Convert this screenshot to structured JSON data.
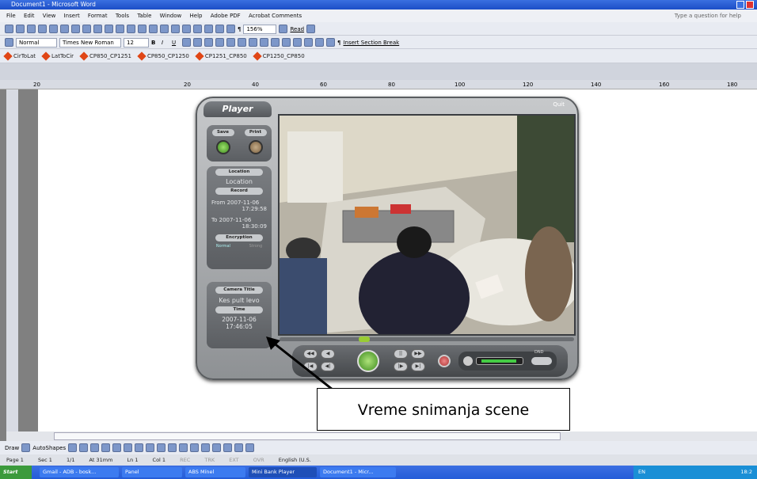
{
  "window": {
    "title": "Document1 - Microsoft Word",
    "help_placeholder": "Type a question for help"
  },
  "menu": [
    "File",
    "Edit",
    "View",
    "Insert",
    "Format",
    "Tools",
    "Table",
    "Window",
    "Help",
    "Adobe PDF",
    "Acrobat Comments"
  ],
  "toolbar": {
    "zoom": "156%",
    "read_label": "Read",
    "style": "Normal",
    "font": "Times New Roman",
    "size": "12",
    "insert_section_break": "Insert Section Break"
  },
  "macros": [
    "CirToLat",
    "LatToCir",
    "CP850_CP1251",
    "CP850_CP1250",
    "CP1251_CP850",
    "CP1250_CP850"
  ],
  "ruler_marks": [
    "20",
    "20",
    "40",
    "60",
    "80",
    "100",
    "120",
    "140",
    "160",
    "180"
  ],
  "player": {
    "title": "Player",
    "quit": "Quit",
    "save_label": "Save",
    "print_label": "Print",
    "location_header": "Location",
    "location_value": "Location",
    "record_header": "Record",
    "from_label": "From",
    "from_date": "2007-11-06",
    "from_time": "17:29:58",
    "to_label": "To",
    "to_date": "2007-11-06",
    "to_time": "18:30:09",
    "encryption_header": "Encryption",
    "encryption_normal": "Normal",
    "encryption_strong": "Strong",
    "camera_title_header": "Camera Title",
    "camera_title_value": "Kes pult levo",
    "time_header": "Time",
    "time_date": "2007-11-06",
    "time_clock": "17:46:05",
    "dnd_label": "DND"
  },
  "annotation": "Vreme snimanja scene",
  "draw_toolbar": {
    "draw": "Draw",
    "autoshapes": "AutoShapes"
  },
  "status": {
    "page": "Page 1",
    "sec": "Sec 1",
    "pages": "1/1",
    "at": "At 31mm",
    "ln": "Ln 1",
    "col": "Col 1",
    "rec": "REC",
    "trk": "TRK",
    "ext": "EXT",
    "ovr": "OVR",
    "lang": "English (U.S."
  },
  "taskbar": {
    "start": "Start",
    "items": [
      "Gmail - ADB - bosk...",
      "Panel",
      "ABS Mínel",
      "Mini Bank Player",
      "Document1 - Micr..."
    ],
    "lang": "EN",
    "clock": "18:2"
  }
}
